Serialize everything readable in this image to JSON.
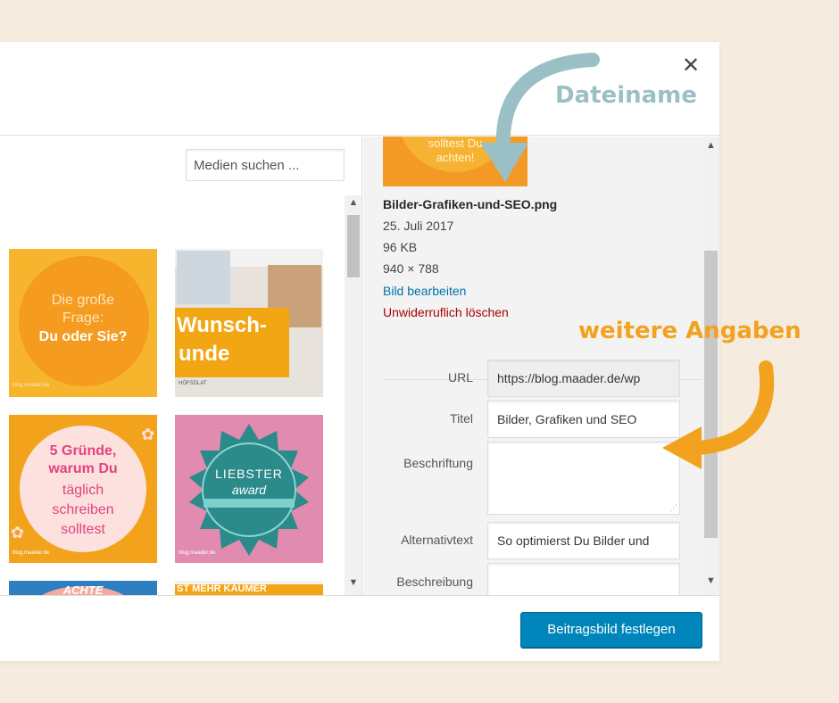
{
  "search": {
    "placeholder": "Medien suchen ..."
  },
  "thumbnails": [
    {
      "line1": "Die große",
      "line2": "Frage:",
      "line3": "Du oder Sie?",
      "footer": "blog.maader.de"
    },
    {
      "line1": "Wunsch-",
      "line2": "unde",
      "small": "HÖFSDLAT"
    },
    {
      "line1": "5 Gründe,",
      "line2": "warum Du",
      "line3": "täglich",
      "line4": "schreiben",
      "line5": "solltest",
      "footer": "blog.maader.de"
    },
    {
      "line1": "LIEBSTER",
      "line2": "award",
      "footer": "blog.maader.de"
    },
    {
      "line1": "ACHTE"
    },
    {
      "line1": "ST MEHR KAUMER"
    }
  ],
  "details": {
    "preview_line1": "solltest Du",
    "preview_line2": "achten!",
    "filename": "Bilder-Grafiken-und-SEO.png",
    "date": "25. Juli 2017",
    "size": "96 KB",
    "dimensions": "940 × 788",
    "edit_link": "Bild bearbeiten",
    "delete_link": "Unwiderruflich löschen",
    "fields": {
      "url_label": "URL",
      "url_value": "https://blog.maader.de/wp",
      "title_label": "Titel",
      "title_value": "Bilder, Grafiken und SEO",
      "caption_label": "Beschriftung",
      "caption_value": "",
      "alt_label": "Alternativtext",
      "alt_value": "So optimierst Du Bilder und",
      "description_label": "Beschreibung",
      "description_value": ""
    }
  },
  "footer": {
    "button_label": "Beitragsbild festlegen"
  },
  "annotations": {
    "dateiname": "Dateiname",
    "weitere": "weitere Angaben"
  },
  "colors": {
    "background": "#f5ecdf",
    "primary_button": "#0085ba",
    "link": "#0073aa",
    "danger": "#aa0000",
    "annotation_blue": "#9ac0c6",
    "annotation_orange": "#f2a21e"
  },
  "icons": {
    "close": "close-icon",
    "resize": "resize-grip-icon"
  }
}
